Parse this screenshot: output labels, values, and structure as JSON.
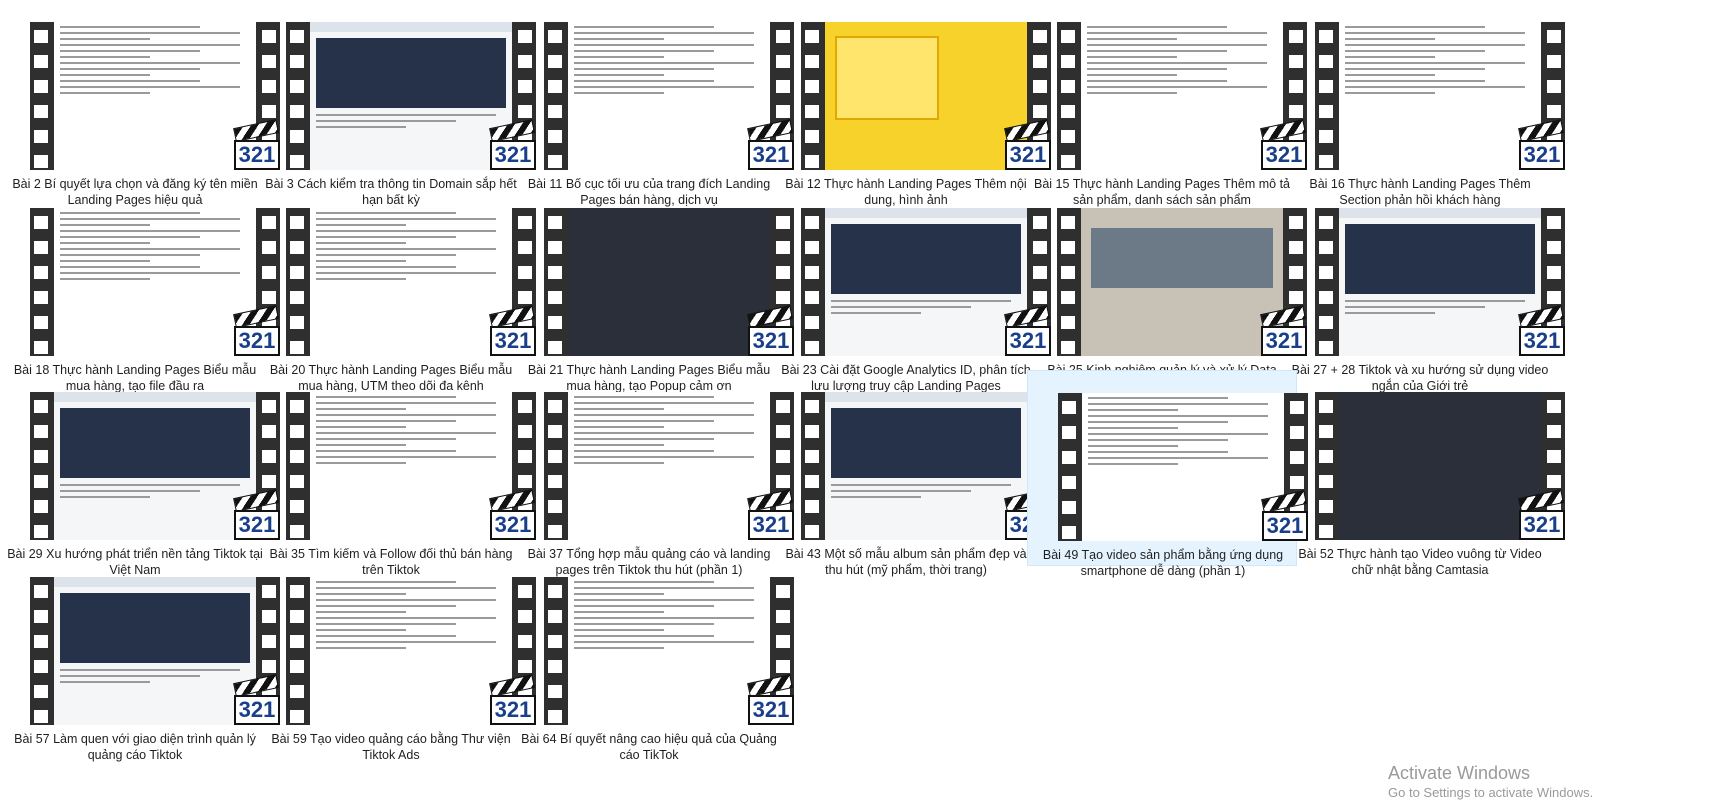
{
  "items": [
    {
      "caption": "Bài 2 Bí quyết lựa chọn và đăng ký tên miền Landing Pages hiệu quả",
      "badge": "321",
      "style": "doc"
    },
    {
      "caption": "Bài 3 Cách kiểm tra thông tin Domain sắp hết hạn bất kỳ",
      "badge": "321",
      "style": "web"
    },
    {
      "caption": "Bài 11 Bố cục tối ưu của trang đích Landing Pages bán hàng, dịch vụ",
      "badge": "321",
      "style": "doc"
    },
    {
      "caption": "Bài 12 Thực hành Landing Pages Thêm nội dung, hình ảnh",
      "badge": "321",
      "style": "yellow"
    },
    {
      "caption": "Bài 15 Thực hành Landing Pages Thêm mô tả sản phẩm, danh sách sản phẩm",
      "badge": "321",
      "style": "doc"
    },
    {
      "caption": "Bài 16 Thực hành Landing Pages Thêm Section phản hồi khách hàng",
      "badge": "321",
      "style": "doc"
    },
    {
      "caption": "Bài 18 Thực hành Landing Pages Biểu mẫu mua hàng, tạo file đầu ra",
      "badge": "321",
      "style": "doc"
    },
    {
      "caption": "Bài 20 Thực hành Landing Pages Biểu mẫu mua hàng, UTM theo dõi đa kênh",
      "badge": "321",
      "style": "doc"
    },
    {
      "caption": "Bài 21 Thực hành Landing Pages Biểu mẫu mua hàng, tạo Popup cảm ơn",
      "badge": "321",
      "style": "dark"
    },
    {
      "caption": "Bài 23 Cài đặt Google Analytics ID, phân tích lưu lượng truy cập Landing Pages",
      "badge": "321",
      "style": "web"
    },
    {
      "caption": "Bài 25 Kinh nghiệm quản lý và xử lý Data khách hàng hiệu quả nhất",
      "badge": "321",
      "style": "photo"
    },
    {
      "caption": "Bài 27 + 28 Tiktok và xu hướng sử dụng video ngắn của Giới trẻ",
      "badge": "321",
      "style": "web"
    },
    {
      "caption": "Bài 29 Xu hướng phát triển nền tảng Tiktok tại Việt Nam",
      "badge": "321",
      "style": "web"
    },
    {
      "caption": "Bài 35 Tìm kiếm và Follow đối thủ bán hàng trên Tiktok",
      "badge": "321",
      "style": "doc"
    },
    {
      "caption": "Bài 37 Tổng hợp mẫu quảng cáo và landing pages trên Tiktok thu hút (phần 1)",
      "badge": "321",
      "style": "doc"
    },
    {
      "caption": "Bài 43 Một số mẫu album sản phẩm đẹp và thu hút (mỹ phẩm, thời trang)",
      "badge": "321",
      "style": "web"
    },
    {
      "caption": "Bài 49 Tạo video sản phẩm bằng ứng dụng smartphone dễ dàng (phần 1)",
      "badge": "321",
      "style": "doc",
      "selected": true
    },
    {
      "caption": "Bài 52 Thực hành tạo Video vuông từ Video chữ nhật bằng Camtasia",
      "badge": "321",
      "style": "dark"
    },
    {
      "caption": "Bài 57 Làm quen với giao diện trình quản lý quảng cáo Tiktok",
      "badge": "321",
      "style": "web"
    },
    {
      "caption": "Bài 59 Tạo video quảng cáo bằng Thư viện Tiktok Ads",
      "badge": "321",
      "style": "doc"
    },
    {
      "caption": "Bài 64 Bí quyết nâng cao hiệu quả của Quảng cáo TikTok",
      "badge": "321",
      "style": "doc"
    }
  ],
  "watermark": {
    "title": "Activate Windows",
    "subtitle": "Go to Settings to activate Windows."
  }
}
